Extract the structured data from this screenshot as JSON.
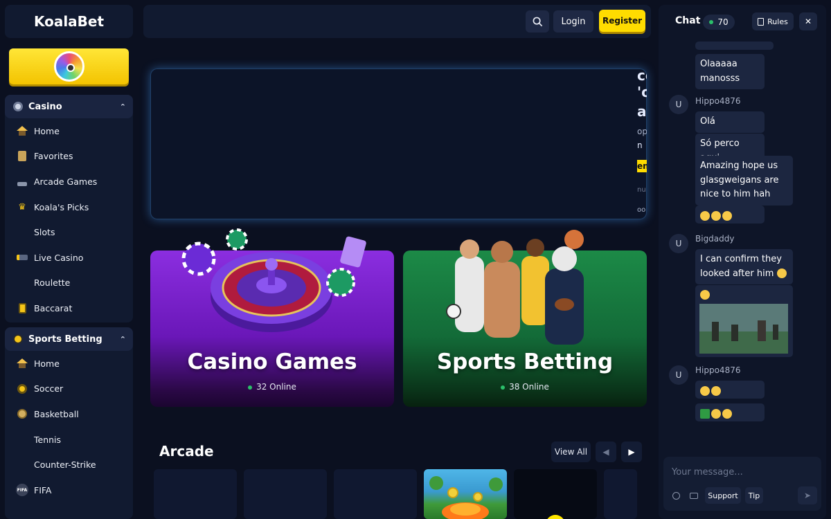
{
  "brand": {
    "name": "KoalaBet"
  },
  "header": {
    "login_label": "Login",
    "register_label": "Register"
  },
  "sidebar": {
    "casino": {
      "title": "Casino",
      "items": [
        {
          "label": "Home",
          "icon": "home-icon"
        },
        {
          "label": "Favorites",
          "icon": "bookmark-icon"
        },
        {
          "label": "Arcade Games",
          "icon": "joystick-icon"
        },
        {
          "label": "Koala's Picks",
          "icon": "crown-icon"
        },
        {
          "label": "Slots",
          "icon": ""
        },
        {
          "label": "Live Casino",
          "icon": "live-camera-icon"
        },
        {
          "label": "Roulette",
          "icon": ""
        },
        {
          "label": "Baccarat",
          "icon": "cards-icon"
        }
      ]
    },
    "sports": {
      "title": "Sports Betting",
      "items": [
        {
          "label": "Home",
          "icon": "home-icon"
        },
        {
          "label": "Soccer",
          "icon": "soccer-ball-icon"
        },
        {
          "label": "Basketball",
          "icon": "basketball-icon"
        },
        {
          "label": "Tennis",
          "icon": ""
        },
        {
          "label": "Counter-Strike",
          "icon": ""
        },
        {
          "label": "FIFA",
          "icon": "fifa-icon"
        }
      ]
    }
  },
  "banner": {
    "peek_text": [
      "ce",
      "'o",
      "a",
      "op",
      "n",
      "en",
      "nu",
      "oo"
    ]
  },
  "categories": [
    {
      "title": "Casino Games",
      "online": "32 Online"
    },
    {
      "title": "Sports Betting",
      "online": "38 Online"
    }
  ],
  "arcade": {
    "title": "Arcade",
    "view_all_label": "View All"
  },
  "chat": {
    "title": "Chat",
    "online_count": "70",
    "rules_label": "Rules",
    "messages": [
      {
        "user": "",
        "text": "Olaaaaa manosss"
      },
      {
        "user": "Hippo4876",
        "texts": [
          "Olá",
          "Só perco aqui",
          "Amazing hope us glasgweigans are nice to him hah"
        ]
      },
      {
        "user": "Bigdaddy",
        "texts": [
          "I can confirm they looked after him"
        ]
      },
      {
        "user": "Hippo4876",
        "texts": []
      }
    ],
    "avatar_letter": "U",
    "input_placeholder": "Your message...",
    "support_label": "Support",
    "tip_label": "Tip"
  },
  "colors": {
    "accent": "#ffdc00",
    "background": "#0b1020",
    "panel": "#111a30",
    "online": "#2bbf6a"
  }
}
